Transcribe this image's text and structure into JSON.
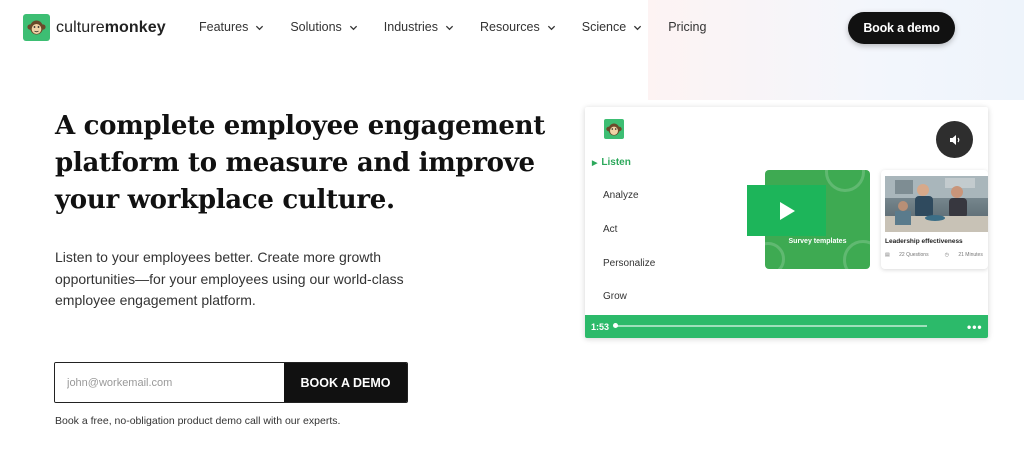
{
  "brand": {
    "name_light": "culture",
    "name_bold": "monkey",
    "accent": "#3dbe73"
  },
  "nav": {
    "items": [
      {
        "label": "Features",
        "has_dropdown": true
      },
      {
        "label": "Solutions",
        "has_dropdown": true
      },
      {
        "label": "Industries",
        "has_dropdown": true
      },
      {
        "label": "Resources",
        "has_dropdown": true
      },
      {
        "label": "Science",
        "has_dropdown": true
      },
      {
        "label": "Pricing",
        "has_dropdown": false
      }
    ],
    "cta_label": "Book a demo"
  },
  "hero": {
    "title_lines": [
      "A complete employee engagement",
      "platform to measure and improve",
      "your workplace culture."
    ],
    "subtitle_lines": [
      "Listen to your employees better. Create more growth",
      "opportunities—for your employees using our world-class",
      "employee engagement platform."
    ],
    "email_placeholder": "john@workemail.com",
    "submit_label": "BOOK A DEMO",
    "note": "Book a free, no-obligation product demo call with our experts."
  },
  "video": {
    "menu": [
      {
        "label": "Listen",
        "active": true
      },
      {
        "label": "Analyze",
        "active": false
      },
      {
        "label": "Act",
        "active": false
      },
      {
        "label": "Personalize",
        "active": false
      },
      {
        "label": "Grow",
        "active": false
      }
    ],
    "survey_card_label": "Survey templates",
    "lead_card": {
      "title": "Leadership effectiveness",
      "questions": "22 Questions",
      "duration": "21 Minutes"
    },
    "time": "1:53",
    "progress_fraction": 0.0,
    "controls_color": "#2cba6a"
  }
}
